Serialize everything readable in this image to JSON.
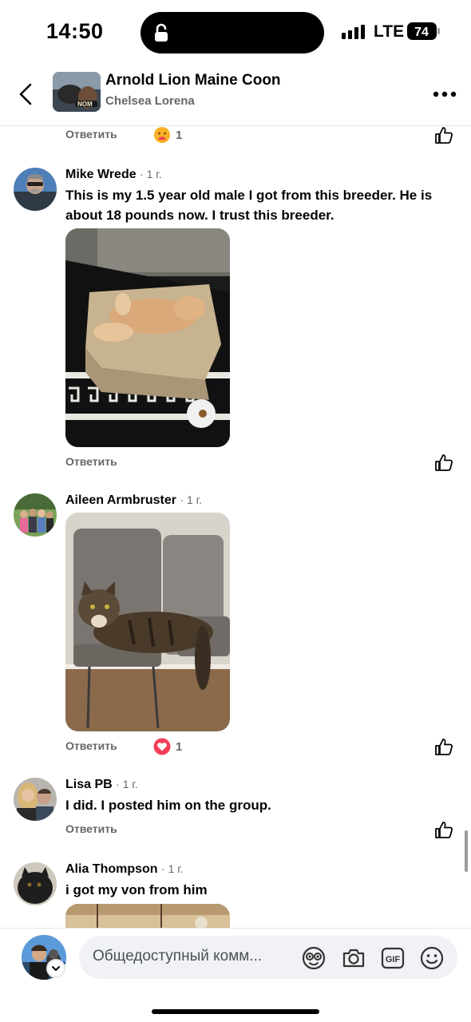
{
  "status": {
    "time": "14:50",
    "network": "LTE",
    "battery": "74"
  },
  "header": {
    "title": "Arnold Lion Maine Coon",
    "subtitle": "Chelsea Lorena",
    "avatar_label": "NOM"
  },
  "comments": [
    {
      "reply_label": "Ответить",
      "reaction_count": "1",
      "reaction": "care"
    },
    {
      "name": "Mike Wrede",
      "ago": "· 1 г.",
      "text": "This is my 1.5 year old male I got from this breeder. He is about 18 pounds now. I trust this breeder.",
      "reply_label": "Ответить"
    },
    {
      "name": "Aileen Armbruster",
      "ago": "· 1 г.",
      "reply_label": "Ответить",
      "reaction_count": "1",
      "reaction": "love"
    },
    {
      "name": "Lisa PB",
      "ago": "· 1 г.",
      "text": "I did. I posted him on the group.",
      "reply_label": "Ответить"
    },
    {
      "name": "Alia Thompson",
      "ago": "· 1 г.",
      "text": "i got my von from him"
    }
  ],
  "composer": {
    "placeholder": "Общедоступный комм..."
  },
  "icons": [
    "lock-icon",
    "signal-icon",
    "battery-icon",
    "back-arrow-icon",
    "more-icon",
    "like-icon",
    "sticker-icon",
    "camera-icon",
    "gif-icon",
    "emoji-icon",
    "chevron-down-icon"
  ],
  "colors": {
    "secondary_text": "#65676b",
    "love": "#f33e58",
    "input_bg": "#f0f2f5"
  }
}
